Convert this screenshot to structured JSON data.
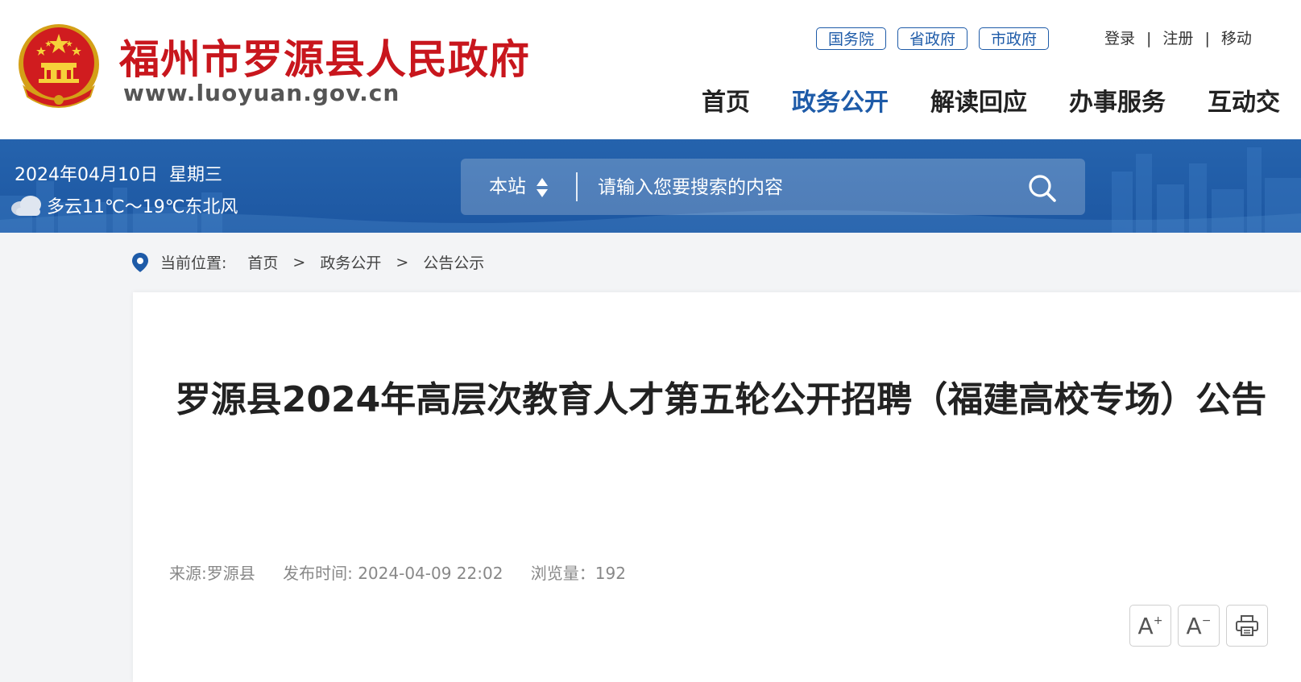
{
  "header": {
    "site_title": "福州市罗源县人民政府",
    "site_url": "www.luoyuan.gov.cn",
    "gov_links": [
      "国务院",
      "省政府",
      "市政府"
    ],
    "user_links": [
      "登录",
      "注册",
      "移动"
    ],
    "nav": [
      "首页",
      "政务公开",
      "解读回应",
      "办事服务",
      "互动交"
    ],
    "active_nav": "政务公开",
    "brand_color": "#c8161d",
    "accent_color": "#1e5ba8"
  },
  "band": {
    "date": "2024年04月10日",
    "weekday": "星期三",
    "weather": "多云11℃～19℃东北风",
    "weather_icon": "cloud-icon",
    "search": {
      "scope": "本站",
      "placeholder": "请输入您要搜索的内容",
      "icon": "search-icon"
    }
  },
  "breadcrumb": {
    "label": "当前位置:",
    "items": [
      "首页",
      "政务公开",
      "公告公示"
    ],
    "separator": ">"
  },
  "article": {
    "title": "罗源县2024年高层次教育人才第五轮公开招聘（福建高校专场）公告",
    "source": "来源:罗源县",
    "publish_time": "发布时间: 2024-04-09 22:02",
    "views": "浏览量：192",
    "tools": {
      "font_larger": "A",
      "font_smaller": "A",
      "plus": "+",
      "minus": "−",
      "print_icon": "printer-icon"
    }
  }
}
